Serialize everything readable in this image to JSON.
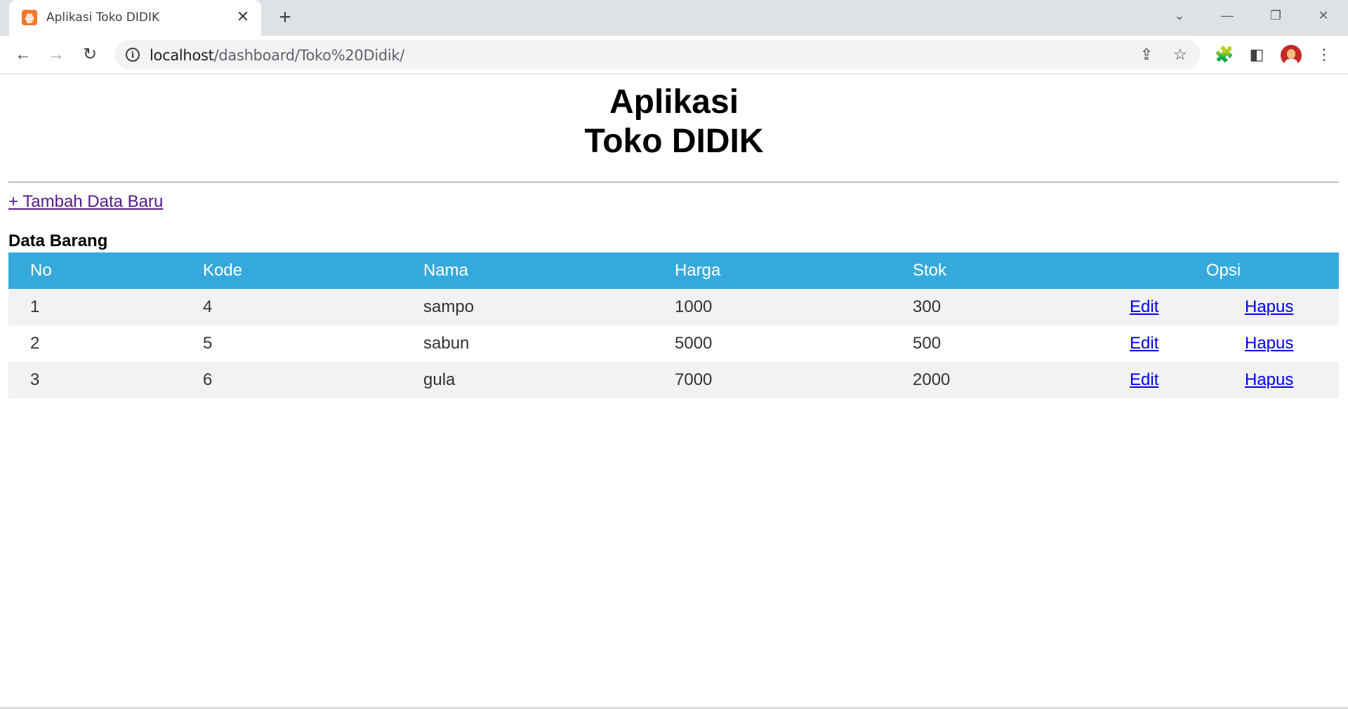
{
  "browser": {
    "tab_title": "Aplikasi Toko DIDIK",
    "favicon": "xampp-icon",
    "url_host": "localhost",
    "url_path": "/dashboard/Toko%20Didik/"
  },
  "page": {
    "title_line1": "Aplikasi",
    "title_line2": "Toko DIDIK",
    "add_link": "+ Tambah Data Baru",
    "table_caption": "Data Barang",
    "columns": [
      "No",
      "Kode",
      "Nama",
      "Harga",
      "Stok",
      "Opsi"
    ],
    "rows": [
      {
        "no": "1",
        "kode": "4",
        "nama": "sampo",
        "harga": "1000",
        "stok": "300",
        "edit": "Edit",
        "hapus": "Hapus"
      },
      {
        "no": "2",
        "kode": "5",
        "nama": "sabun",
        "harga": "5000",
        "stok": "500",
        "edit": "Edit",
        "hapus": "Hapus"
      },
      {
        "no": "3",
        "kode": "6",
        "nama": "gula",
        "harga": "7000",
        "stok": "2000",
        "edit": "Edit",
        "hapus": "Hapus"
      }
    ],
    "colors": {
      "header_bg": "#36a9dc",
      "header_text": "#ffffff",
      "row_striped": "#f2f2f2",
      "link_visited": "#551a8b",
      "link": "#0000ee"
    }
  }
}
